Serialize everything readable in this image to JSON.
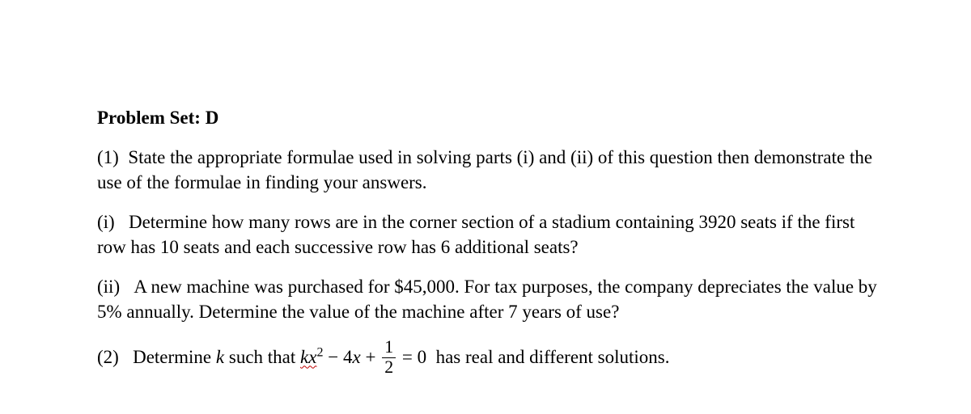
{
  "title": "Problem Set: D",
  "q1": {
    "num": "(1)",
    "intro": "State the appropriate formulae used in solving parts (i) and (ii) of this question then demonstrate the use of the formulae in finding your answers.",
    "part_i": {
      "num": "(i)",
      "text": "Determine how many rows are in the corner section of a stadium containing 3920 seats if the first row has 10 seats and each successive row has 6 additional seats?"
    },
    "part_ii": {
      "num": "(ii)",
      "text": "A new machine was purchased for $45,000. For tax purposes, the company depreciates the value by 5% annually. Determine the value of the machine after 7 years of use?"
    }
  },
  "q2": {
    "num": "(2)",
    "lead": "Determine ",
    "k": "k",
    "mid": " such that ",
    "kx": "kx",
    "sq": "2",
    "minus": " − 4",
    "x": "x",
    "plus": " + ",
    "frac_num": "1",
    "frac_den": "2",
    "eq": " = 0",
    "tail": " has real and different solutions."
  }
}
